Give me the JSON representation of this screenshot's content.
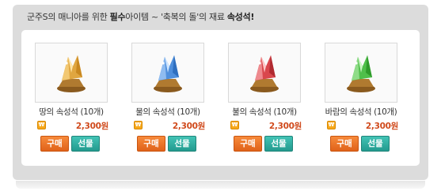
{
  "headline": {
    "prefix": "군주S의 매니아를 위한 ",
    "emphasis1": "필수",
    "middle": "아이템 ~ '축복의 돌'의 재료 ",
    "emphasis2": "속성석!"
  },
  "items": [
    {
      "name": "땅의 속성석 (10개)",
      "price": "2,300원",
      "buy_label": "구매",
      "gift_label": "선물",
      "gem_color": "#e0a640",
      "gem_light": "#ffe6a8",
      "icon": "earth-gem-icon"
    },
    {
      "name": "물의 속성석 (10개)",
      "price": "2,300원",
      "buy_label": "구매",
      "gift_label": "선물",
      "gem_color": "#4f8fdc",
      "gem_light": "#cfe6ff",
      "icon": "water-gem-icon"
    },
    {
      "name": "불의 속성석 (10개)",
      "price": "2,300원",
      "buy_label": "구매",
      "gift_label": "선물",
      "gem_color": "#d9474d",
      "gem_light": "#ffc7c7",
      "icon": "fire-gem-icon"
    },
    {
      "name": "바람의 속성석 (10개)",
      "price": "2,300원",
      "buy_label": "구매",
      "gift_label": "선물",
      "gem_color": "#4fbf4a",
      "gem_light": "#c9f5c2",
      "icon": "wind-gem-icon"
    }
  ],
  "coin_symbol": "₩",
  "colors": {
    "buy": "#e96d24",
    "gift": "#2fae9f",
    "price": "#d04a1c"
  }
}
